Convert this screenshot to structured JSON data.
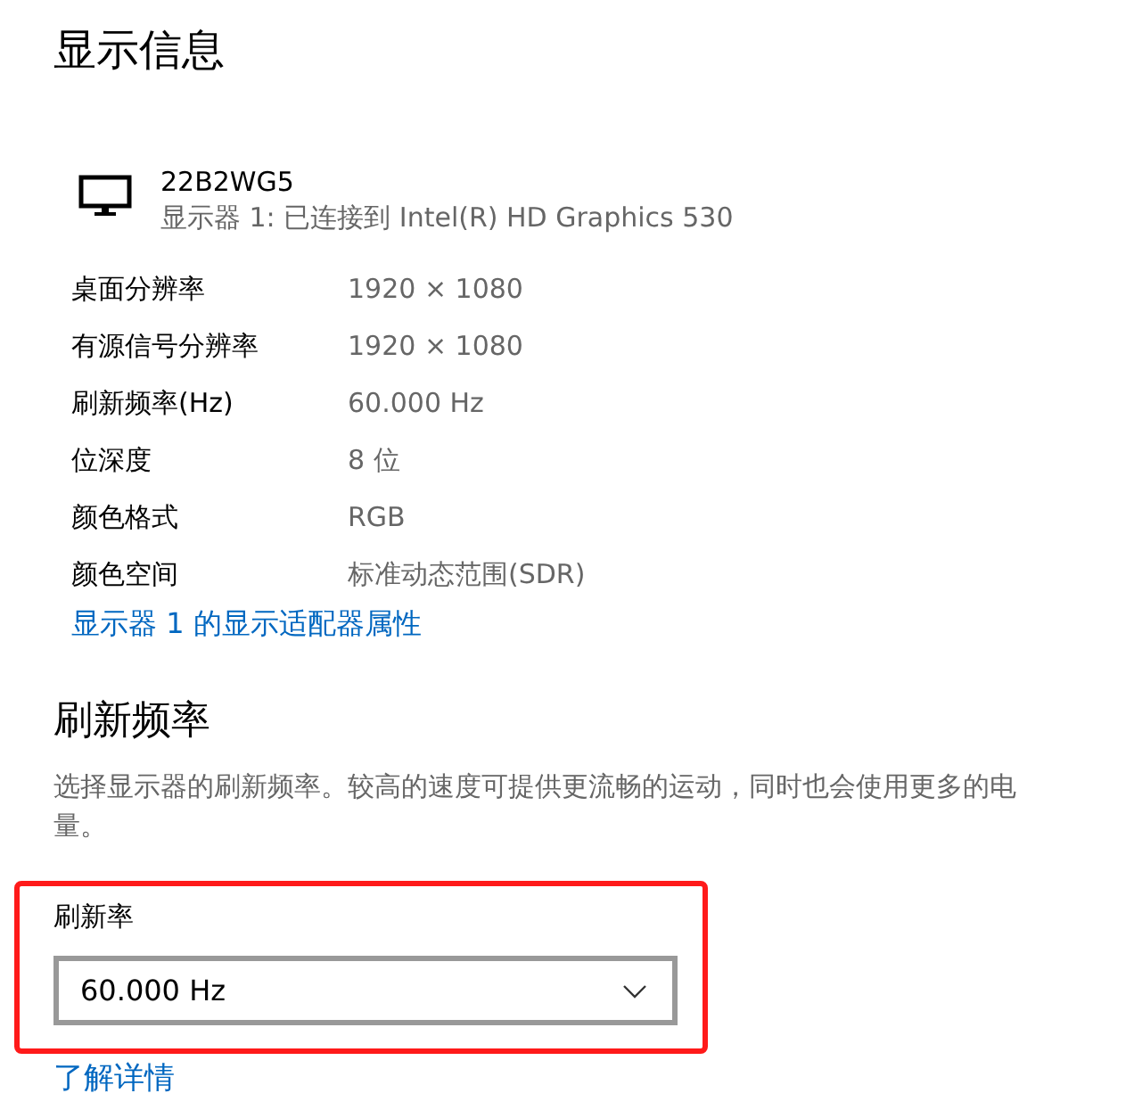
{
  "title": "显示信息",
  "display": {
    "name": "22B2WG5",
    "subtitle": "显示器 1: 已连接到 Intel(R) HD Graphics 530"
  },
  "properties": [
    {
      "label": "桌面分辨率",
      "value": "1920 × 1080"
    },
    {
      "label": "有源信号分辨率",
      "value": "1920 × 1080"
    },
    {
      "label": "刷新频率(Hz)",
      "value": "60.000 Hz"
    },
    {
      "label": "位深度",
      "value": "8 位"
    },
    {
      "label": "颜色格式",
      "value": "RGB"
    },
    {
      "label": "颜色空间",
      "value": "标准动态范围(SDR)"
    }
  ],
  "adapter_link": "显示器 1 的显示适配器属性",
  "refresh_section": {
    "heading": "刷新频率",
    "description": "选择显示器的刷新频率。较高的速度可提供更流畅的运动，同时也会使用更多的电量。",
    "highlighted": true,
    "field_label": "刷新率",
    "dropdown_value": "60.000 Hz",
    "link": "了解详情"
  }
}
